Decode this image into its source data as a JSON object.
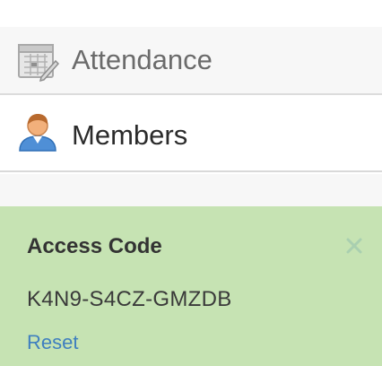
{
  "nav": {
    "items": [
      {
        "label": "Attendance",
        "icon": "attendance-icon"
      },
      {
        "label": "Members",
        "icon": "member-icon"
      }
    ]
  },
  "access_panel": {
    "title": "Access Code",
    "code": "K4N9-S4CZ-GMZDB",
    "reset_label": "Reset",
    "close_icon": "close-icon"
  },
  "colors": {
    "panel_background": "#c6e3b3",
    "link": "#3f7fbf",
    "close": "#a9cfb0"
  }
}
